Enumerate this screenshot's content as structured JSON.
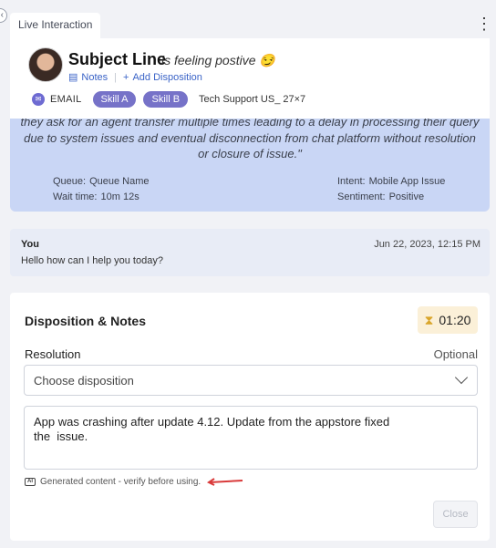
{
  "tab": {
    "label": "Live Interaction"
  },
  "header": {
    "subject": "Subject Line",
    "feeling": "is feeling postive 😏",
    "notes_label": "Notes",
    "add_disposition_label": "Add Disposition",
    "channel": "EMAIL",
    "skills": [
      "Skill A",
      "Skill B"
    ],
    "queue": "Tech Support US_ 27×7"
  },
  "summary": {
    "text": "they ask for an agent transfer multiple times leading to a delay in processing their query due to system issues and eventual disconnection from chat platform without resolution or closure of issue.\"",
    "queue_label": "Queue:",
    "queue_value": "Queue Name",
    "wait_label": "Wait time:",
    "wait_value": "10m 12s",
    "intent_label": "Intent:",
    "intent_value": "Mobile App Issue",
    "sentiment_label": "Sentiment:",
    "sentiment_value": "Positive"
  },
  "message": {
    "author": "You",
    "timestamp": "Jun 22, 2023, 12:15 PM",
    "text": "Hello how can I help you today?"
  },
  "disposition": {
    "title": "Disposition & Notes",
    "timer": "01:20",
    "resolution_label": "Resolution",
    "optional_label": "Optional",
    "select_value": "Choose disposition",
    "notes_text": "App was crashing after update 4.12. Update from the appstore fixed\nthe  issue.",
    "generated_note": "Generated content - verify before using.",
    "close_label": "Close"
  },
  "colors": {
    "skill_badge": "#7672c8",
    "summary_bg": "#c9d6f5",
    "link": "#3a63c7",
    "annotation_arrow": "#d93a3a"
  }
}
